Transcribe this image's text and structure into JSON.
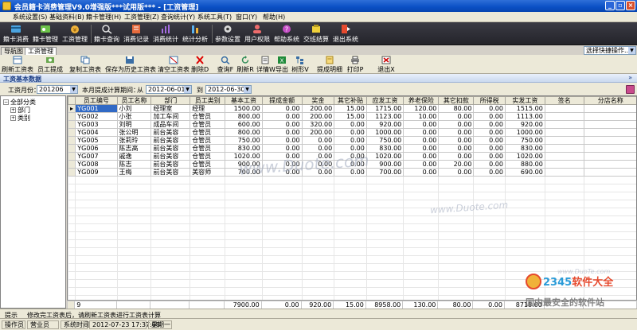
{
  "window": {
    "title": "会员籍卡消费管理V9.0增强版***试用版*** - [工资管理]",
    "buttons": {
      "minimize": "_",
      "restore": "▫",
      "close": "×"
    }
  },
  "menu": [
    "系统设置(S)",
    "基础资料(B)",
    "籍卡管理(H)",
    "工资管理(Z)",
    "查询统计(Y)",
    "系统工具(T)",
    "窗口(Y)",
    "帮助(H)"
  ],
  "main_toolbar": [
    {
      "label": "籍卡消费",
      "icon": "card-consume-icon",
      "color": "#4aa3df"
    },
    {
      "label": "籍卡管理",
      "icon": "card-manage-icon",
      "color": "#6cc24a"
    },
    {
      "label": "工资管理",
      "icon": "salary-icon",
      "color": "#f0b23a"
    },
    {
      "label": "籍卡查询",
      "icon": "card-query-icon",
      "color": "#e0e0e0"
    },
    {
      "label": "消费记录",
      "icon": "record-icon",
      "color": "#e66a3c"
    },
    {
      "label": "消费统计",
      "icon": "stats-icon",
      "color": "#a56de2"
    },
    {
      "label": "统计分析",
      "icon": "analysis-icon",
      "color": "#5ab1ef"
    },
    {
      "label": "参数设置",
      "icon": "settings-icon",
      "color": "#d9d9d9"
    },
    {
      "label": "用户权限",
      "icon": "user-perm-icon",
      "color": "#ef6c6c"
    },
    {
      "label": "帮助系统",
      "icon": "help-icon",
      "color": "#c44dc4"
    },
    {
      "label": "交班结算",
      "icon": "settle-icon",
      "color": "#f0d03a"
    },
    {
      "label": "退出系统",
      "icon": "exit-icon",
      "color": "#e64a2e"
    }
  ],
  "nav_tabs": [
    "导航图",
    "工资管理"
  ],
  "quick_select": "选择快捷操作...",
  "work_toolbar": [
    {
      "label": "刷新工资表",
      "icon": "refresh-table-icon"
    },
    {
      "label": "员工提成",
      "icon": "commission-icon"
    },
    {
      "label": "复制工资表",
      "icon": "copy-table-icon"
    },
    {
      "label": "保存为历史工资表",
      "icon": "save-history-icon"
    },
    {
      "label": "清空工资表",
      "icon": "clear-table-icon"
    },
    {
      "label": "删除D",
      "icon": "delete-icon"
    },
    {
      "label": "查询F",
      "icon": "search-icon"
    },
    {
      "label": "刷新R",
      "icon": "refresh-icon"
    },
    {
      "label": "详情W",
      "icon": "detail-icon"
    },
    {
      "label": "导出",
      "icon": "export-icon"
    },
    {
      "label": "树形V",
      "icon": "tree-icon"
    },
    {
      "label": "提成明细",
      "icon": "commission-detail-icon"
    },
    {
      "label": "打印P",
      "icon": "printer-icon"
    },
    {
      "label": "退出X",
      "icon": "exit-small-icon"
    }
  ],
  "section": {
    "title": "工资基本数据",
    "arrow": "»"
  },
  "filter": {
    "month_label": "工资月份：",
    "month_value": "201206",
    "period_label": "本月提成计算期间：",
    "from_op": "从",
    "from_date": "2012-06-01",
    "to_op": "到",
    "to_date": "2012-06-30"
  },
  "tree": {
    "root": "全部分类",
    "children": [
      "部门",
      "类别"
    ]
  },
  "grid": {
    "columns": [
      "员工编号",
      "员工名称",
      "部门",
      "员工类别",
      "基本工资",
      "提成金额",
      "奖金",
      "其它补贴",
      "应发工资",
      "养老保险",
      "其它扣款",
      "所得税",
      "实发工资",
      "签名",
      "分店名称"
    ],
    "rows": [
      [
        "YG001",
        "小刘",
        "经理室",
        "经理",
        "1500.00",
        "0.00",
        "200.00",
        "15.00",
        "1715.00",
        "120.00",
        "80.00",
        "0.00",
        "1515.00",
        "",
        ""
      ],
      [
        "YG002",
        "小张",
        "加工车间",
        "仓管员",
        "800.00",
        "0.00",
        "200.00",
        "15.00",
        "1123.00",
        "10.00",
        "0.00",
        "0.00",
        "1113.00",
        "",
        ""
      ],
      [
        "YG003",
        "刘明",
        "成品车间",
        "仓管员",
        "600.00",
        "0.00",
        "320.00",
        "0.00",
        "920.00",
        "0.00",
        "0.00",
        "0.00",
        "920.00",
        "",
        ""
      ],
      [
        "YG004",
        "张公明",
        "前台美容",
        "仓管员",
        "800.00",
        "0.00",
        "200.00",
        "0.00",
        "1000.00",
        "0.00",
        "0.00",
        "0.00",
        "1000.00",
        "",
        ""
      ],
      [
        "YG005",
        "张莉玲",
        "前台美容",
        "仓管员",
        "750.00",
        "0.00",
        "0.00",
        "0.00",
        "750.00",
        "0.00",
        "0.00",
        "0.00",
        "750.00",
        "",
        ""
      ],
      [
        "YG006",
        "陈志高",
        "前台美容",
        "仓管员",
        "830.00",
        "0.00",
        "0.00",
        "0.00",
        "830.00",
        "0.00",
        "0.00",
        "0.00",
        "830.00",
        "",
        ""
      ],
      [
        "YG007",
        "戚逸",
        "前台美容",
        "仓管员",
        "1020.00",
        "0.00",
        "0.00",
        "0.00",
        "1020.00",
        "0.00",
        "0.00",
        "0.00",
        "1020.00",
        "",
        ""
      ],
      [
        "YG008",
        "陈志",
        "前台美容",
        "仓管员",
        "900.00",
        "0.00",
        "0.00",
        "0.00",
        "900.00",
        "0.00",
        "20.00",
        "0.00",
        "880.00",
        "",
        ""
      ],
      [
        "YG009",
        "王梅",
        "前台美容",
        "美容师",
        "700.00",
        "0.00",
        "0.00",
        "0.00",
        "700.00",
        "0.00",
        "0.00",
        "0.00",
        "690.00",
        "",
        ""
      ]
    ],
    "footer": [
      "9",
      "",
      "",
      "",
      "7900.00",
      "0.00",
      "920.00",
      "15.00",
      "8958.00",
      "130.00",
      "80.00",
      "0.00",
      "8718.00",
      "",
      ""
    ]
  },
  "hint": {
    "label": "提示",
    "text": "修改完工资表后，请刷新工资表进行工资表计算"
  },
  "status": {
    "operator_label": "操作员",
    "operator_value": "营业员",
    "time_label": "系统时间",
    "time_value": "2012-07-23  17:37:08",
    "weekday": "星期一"
  },
  "watermark": {
    "text": "www.Duote.com",
    "logo": "2345软件大全",
    "logo_accent": "2345",
    "slogan": "国内最安全的软件站",
    "corner": "www.DuoTe.com"
  }
}
